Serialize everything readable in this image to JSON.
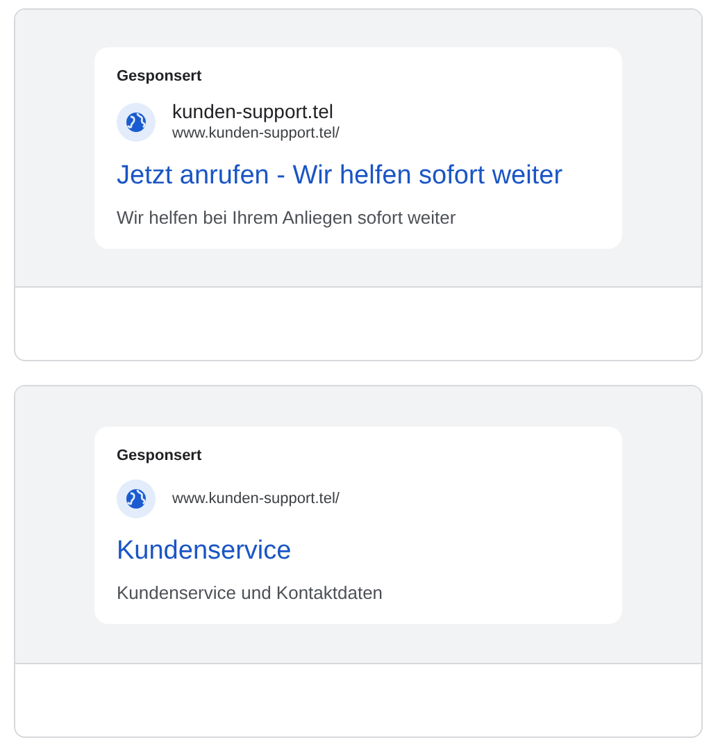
{
  "ads": [
    {
      "label": "Gesponsert",
      "site_name": "kunden-support.tel",
      "url": "www.kunden-support.tel/",
      "title": "Jetzt anrufen - Wir helfen sofort weiter",
      "description": "Wir helfen bei Ihrem Anliegen sofort weiter"
    },
    {
      "label": "Gesponsert",
      "url": "www.kunden-support.tel/",
      "title": "Kundenservice",
      "description": "Kundenservice und Kontaktdaten"
    }
  ]
}
